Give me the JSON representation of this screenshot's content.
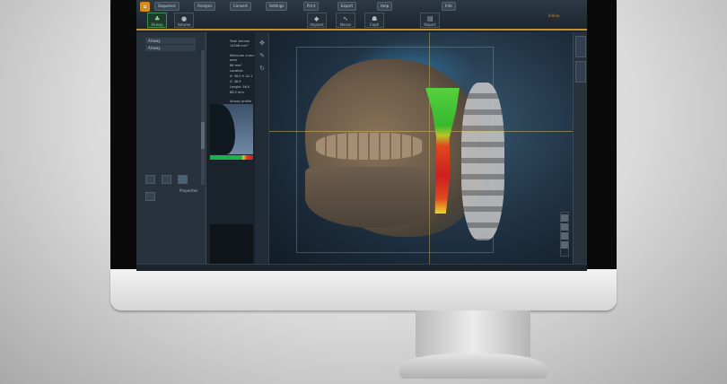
{
  "toolbar": {
    "buttons": [
      "Sequence",
      "Analysis",
      "Convert",
      "Settings",
      "Print",
      "Export",
      "Help",
      "Info"
    ],
    "tabs": [
      {
        "label": "Airway",
        "icon": "lungs-icon"
      },
      {
        "label": "Volume",
        "icon": "sphere-icon"
      },
      {
        "label": "Implant",
        "icon": "tooth-icon"
      },
      {
        "label": "Nerve",
        "icon": "curve-icon"
      },
      {
        "label": "Ceph",
        "icon": "skull-icon"
      },
      {
        "label": "Report",
        "icon": "doc-icon"
      }
    ],
    "brand": "InVivo"
  },
  "left_panel": {
    "items": [
      "Airway",
      "Airway"
    ],
    "footer_label": "Properties"
  },
  "info_panel": {
    "lines": [
      "Total Volume",
      "14046 mm³",
      "Minimum cross section",
      "area",
      "86 mm²",
      "Location",
      "X: 56.0  Y: 42.1",
      "Z: 48.9",
      "Length: 56.0",
      "88.2 mm",
      "Airway profile"
    ]
  },
  "colors": {
    "accent": "#c8922a",
    "green": "#19b24a",
    "yellow": "#e8c021",
    "red": "#c91d1d"
  }
}
